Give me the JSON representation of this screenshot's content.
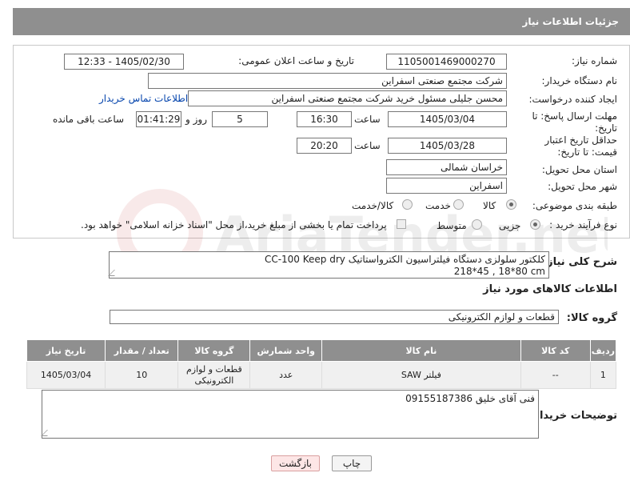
{
  "header": {
    "title": "جزئیات اطلاعات نیاز"
  },
  "fields": {
    "need_number_label": "شماره نیاز:",
    "need_number": "1105001469000270",
    "announce_label": "تاریخ و ساعت اعلان عمومی:",
    "announce_value": "1405/02/30 - 12:33",
    "buyer_org_label": "نام دستگاه خریدار:",
    "buyer_org": "شرکت مجتمع صنعتی اسفراین",
    "creator_label": "ایجاد کننده درخواست:",
    "creator": "محسن جلیلی مسئول خرید شرکت مجتمع صنعتی اسفراین",
    "contact_link": "اطلاعات تماس خریدار",
    "deadline_label": "مهلت ارسال پاسخ: تا تاریخ:",
    "deadline_date": "1405/03/04",
    "time_word": "ساعت",
    "deadline_time": "16:30",
    "days": "5",
    "days_word": "روز و",
    "remaining": "01:41:29",
    "remaining_word": "ساعت باقی مانده",
    "min_price_label": "حداقل تاریخ اعتبار قیمت: تا تاریخ:",
    "min_price_date": "1405/03/28",
    "min_price_time": "20:20",
    "province_label": "استان محل تحویل:",
    "province": "خراسان شمالی",
    "city_label": "شهر محل تحویل:",
    "city": "اسفراین",
    "category_label": "طبقه بندی موضوعی:",
    "cat_opt1": "کالا",
    "cat_opt2": "خدمت",
    "cat_opt3": "کالا/خدمت",
    "process_label": "نوع فرآیند خرید :",
    "proc_opt1": "جزیی",
    "proc_opt2": "متوسط",
    "payment_note": "پرداخت تمام یا بخشی از مبلغ خرید،از محل \"اسناد خزانه اسلامی\" خواهد بود."
  },
  "description": {
    "label": "شرح کلی نیاز:",
    "text_line1": "کلکتور سلولزی دستگاه فیلتراسیون الکترواستاتیک CC-100 Keep dry",
    "text_line2": "218*45 , 18*80 cm"
  },
  "goods_info_title": "اطلاعات کالاهای مورد نیاز",
  "goods_group": {
    "label": "گروه کالا:",
    "value": "قطعات و لوازم الکترونیکی"
  },
  "table": {
    "headers": [
      "ردیف",
      "کد کالا",
      "نام کالا",
      "واحد شمارش",
      "گروه کالا",
      "تعداد / مقدار",
      "تاریخ نیاز"
    ],
    "rows": [
      [
        "1",
        "--",
        "فیلتر SAW",
        "عدد",
        "قطعات و لوازم الکترونیکی",
        "10",
        "1405/03/04"
      ]
    ]
  },
  "buyer_notes": {
    "label": "توضیحات خریدار:",
    "text": "فنی آقای خلیق 09155187386"
  },
  "buttons": {
    "print": "چاپ",
    "back": "بازگشت"
  },
  "watermark_text": "AriaTender.net"
}
